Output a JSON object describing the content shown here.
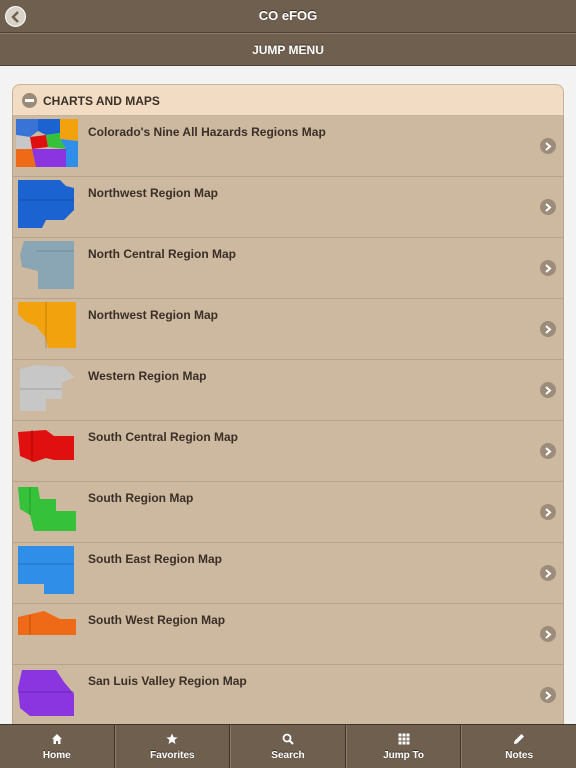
{
  "header": {
    "title": "CO eFOG",
    "back_icon": "chevron-left-icon"
  },
  "jump": {
    "title": "JUMP MENU"
  },
  "section": {
    "title": "CHARTS AND MAPS",
    "icon": "minus-icon"
  },
  "items": [
    {
      "label": "Colorado's Nine All Hazards Regions Map",
      "thumb_color": "#3a73d6"
    },
    {
      "label": "Northwest Region Map",
      "thumb_color": "#1b63d1"
    },
    {
      "label": "North Central Region Map",
      "thumb_color": "#8aa5b3"
    },
    {
      "label": "Northwest Region Map",
      "thumb_color": "#f2a20d"
    },
    {
      "label": "Western Region Map",
      "thumb_color": "#c7c7c7"
    },
    {
      "label": "South Central Region Map",
      "thumb_color": "#e01010"
    },
    {
      "label": "South Region Map",
      "thumb_color": "#35c23a"
    },
    {
      "label": "South East Region Map",
      "thumb_color": "#2f8ee8"
    },
    {
      "label": "South West Region Map",
      "thumb_color": "#ee6a16"
    },
    {
      "label": "San Luis Valley Region Map",
      "thumb_color": "#8a35e0"
    }
  ],
  "tabs": [
    {
      "label": "Home",
      "icon": "home-icon"
    },
    {
      "label": "Favorites",
      "icon": "star-icon"
    },
    {
      "label": "Search",
      "icon": "search-icon"
    },
    {
      "label": "Jump To",
      "icon": "grid-icon"
    },
    {
      "label": "Notes",
      "icon": "pencil-icon"
    }
  ]
}
